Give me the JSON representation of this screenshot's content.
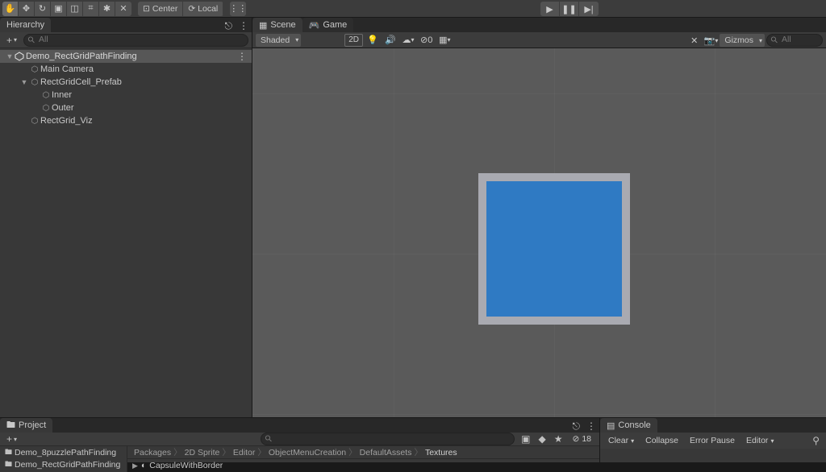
{
  "top_toolbar": {
    "transform_tools": [
      "✋",
      "✥",
      "↻",
      "▣",
      "◫",
      "⌗",
      "✱",
      "✕"
    ],
    "handle_btns": {
      "center": "Center",
      "local": "Local"
    },
    "grid_snap": "⋮⋮"
  },
  "playback": {
    "play": "▶",
    "pause": "❚❚",
    "step": "▶|"
  },
  "hierarchy": {
    "tab": "Hierarchy",
    "add": "+",
    "search_placeholder": "All",
    "scene_name": "Demo_RectGridPathFinding",
    "items": [
      {
        "indent": 1,
        "name": "Main Camera"
      },
      {
        "indent": 1,
        "name": "RectGridCell_Prefab",
        "expandable": true
      },
      {
        "indent": 2,
        "name": "Inner"
      },
      {
        "indent": 2,
        "name": "Outer"
      },
      {
        "indent": 1,
        "name": "RectGrid_Viz"
      }
    ]
  },
  "sceneview": {
    "tab_scene": "Scene",
    "tab_game": "Game",
    "draw_mode": "Shaded",
    "mode2d": "2D",
    "gizmos_label": "Gizmos",
    "hidden_badge": "0",
    "search_placeholder": "All"
  },
  "project": {
    "tab": "Project",
    "search_placeholder": "",
    "add": "+",
    "hidden_count": "18",
    "tree": [
      "Demo_8puzzlePathFinding",
      "Demo_RectGridPathFinding"
    ],
    "breadcrumb": [
      "Packages",
      "2D Sprite",
      "Editor",
      "ObjectMenuCreation",
      "DefaultAssets",
      "Textures"
    ],
    "list_item": "CapsuleWithBorder"
  },
  "console": {
    "tab": "Console",
    "btn_clear": "Clear",
    "btn_collapse": "Collapse",
    "btn_errorpause": "Error Pause",
    "btn_editor": "Editor"
  }
}
